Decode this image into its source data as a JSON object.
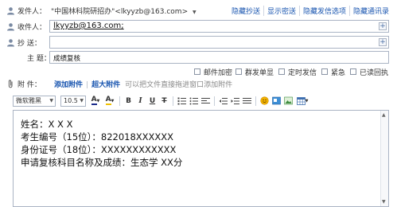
{
  "sender": {
    "label": "发件人：",
    "value": "\"中国林科院研招办\"<lkyyzb@163.com>",
    "dropdown": "▼"
  },
  "header_links": [
    "隐藏抄送",
    "显示密送",
    "隐藏发信选项",
    "隐藏通讯录"
  ],
  "to": {
    "label": "收件人：",
    "value": "lkyyzb@163.com;"
  },
  "cc": {
    "label": "抄  送：",
    "value": ""
  },
  "subject": {
    "label": "主  题：",
    "value": "成绩复核"
  },
  "options": [
    "邮件加密",
    "群发单显",
    "定时发信",
    "紧急",
    "已读回执"
  ],
  "attachment": {
    "label": "附  件：",
    "add": "添加附件",
    "large": "超大附件",
    "hint": "可以把文件直接拖进窗口添加附件"
  },
  "toolbar": {
    "font": "微软雅黑",
    "size": "10.5",
    "bold": "B",
    "italic": "I",
    "underline": "U",
    "strike": "T"
  },
  "body_lines": [
    "姓名：X X X",
    "考生编号（15位）：822018XXXXXX",
    "身份证号（18位）：XXXXXXXXXXXX",
    "申请复核科目名称及成绩：生态学  XX分"
  ],
  "colors": {
    "link": "#1a56b0",
    "border": "#aab4c4"
  }
}
